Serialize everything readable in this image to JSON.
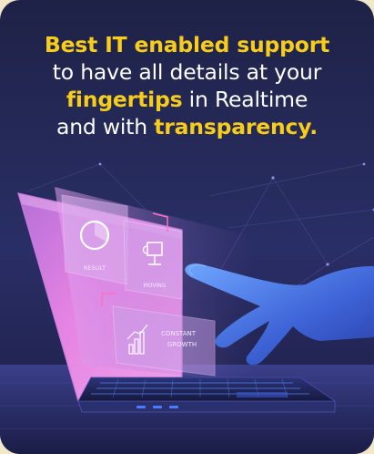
{
  "headline": {
    "line1_highlight": "Best IT enabled support",
    "line2_plain": "to have all details at your",
    "line3_highlight": "fingertips",
    "line3_plain": " in Realtime",
    "line4_plain": "and with ",
    "line4_highlight": "transparency."
  },
  "panels": {
    "result_label": "RESULT",
    "moving_label": "MOVING",
    "constant_growth_line1": "CONSTANT",
    "constant_growth_line2": "GROWTH"
  },
  "colors": {
    "background_top": "#1e2247",
    "background_bottom": "#1b1e44",
    "highlight": "#f7cc1b",
    "text": "#ffffff",
    "screen_pink": "#e07be0",
    "hand_blue": "#4f7ee8",
    "frame": "#f3e7c9"
  },
  "icons": [
    "pie-chart-icon",
    "trophy-icon",
    "bar-growth-icon",
    "hand-icon",
    "laptop-icon"
  ]
}
